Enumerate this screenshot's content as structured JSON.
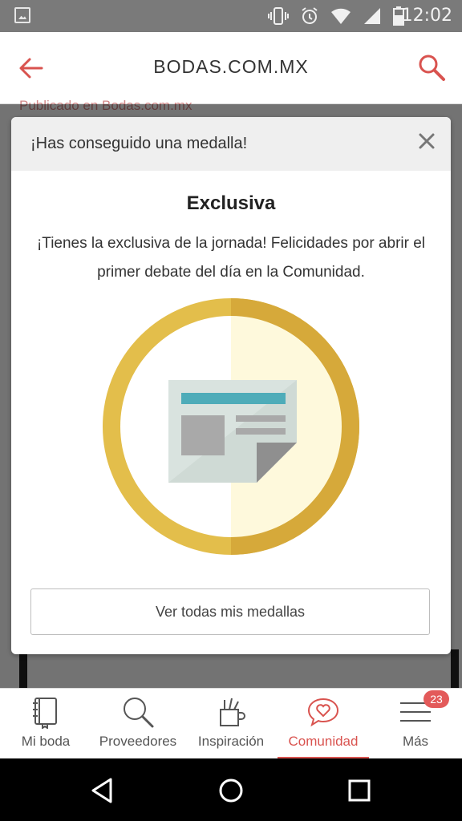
{
  "status_bar": {
    "time": "12:02"
  },
  "app_bar": {
    "title": "BODAS.COM.MX"
  },
  "background": {
    "published_text": "Publicado en Bodas.com.mx"
  },
  "modal": {
    "header": "¡Has conseguido una medalla!",
    "medal_name": "Exclusiva",
    "description": "¡Tienes la exclusiva de la jornada! Felicidades por abrir el primer debate del día en la Comunidad.",
    "button_label": "Ver todas mis medallas",
    "medal_colors": {
      "ring": "#d9b13c",
      "ring_dark": "#d1a632",
      "inner_left": "#ffffff",
      "inner_right": "#fef9dc",
      "doc_bar": "#4eacb9"
    }
  },
  "tab_bar": {
    "items": [
      {
        "label": "Mi boda",
        "icon": "book-icon",
        "active": false
      },
      {
        "label": "Proveedores",
        "icon": "magnifier-icon",
        "active": false
      },
      {
        "label": "Inspiración",
        "icon": "pencil-cup-icon",
        "active": false
      },
      {
        "label": "Comunidad",
        "icon": "heart-chat-icon",
        "active": true
      },
      {
        "label": "Más",
        "icon": "menu-icon",
        "active": false
      }
    ],
    "badge_count": "23"
  },
  "colors": {
    "accent": "#d9534f"
  }
}
